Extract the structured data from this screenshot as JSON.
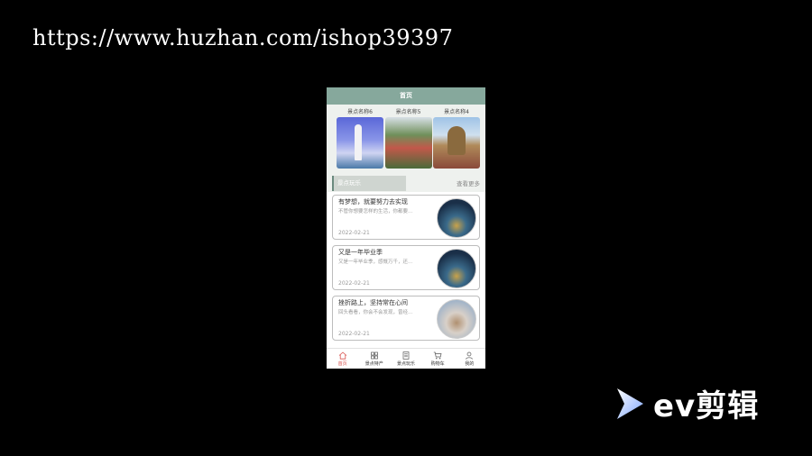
{
  "watermark_url": "https://www.huzhan.com/ishop39397",
  "app": {
    "title": "首页",
    "scenic_spots": [
      {
        "name": "景点名称6",
        "image": "guanyin-statue-photo"
      },
      {
        "name": "景点名称5",
        "image": "mountain-cliff-photo"
      },
      {
        "name": "景点名称4",
        "image": "giant-buddha-photo"
      }
    ],
    "section": {
      "tab_label": "景点玩乐",
      "more_label": "查看更多"
    },
    "articles": [
      {
        "title": "有梦想，就要努力去实现",
        "desc": "不管你想要怎样的生活，你都要...",
        "date": "2022-02-21"
      },
      {
        "title": "又是一年毕业季",
        "desc": "又是一年毕业季，感慨万千，还...",
        "date": "2022-02-21"
      },
      {
        "title": "挫折路上，坚持常在心间",
        "desc": "回头看看，你会不会发现，曾经...",
        "date": "2022-02-21"
      }
    ],
    "tabbar": [
      {
        "label": "首页",
        "icon": "home-icon",
        "active": true
      },
      {
        "label": "景点特产",
        "icon": "grid-icon",
        "active": false
      },
      {
        "label": "景点玩乐",
        "icon": "document-icon",
        "active": false
      },
      {
        "label": "购物车",
        "icon": "cart-icon",
        "active": false
      },
      {
        "label": "我的",
        "icon": "user-icon",
        "active": false
      }
    ]
  },
  "logo": {
    "text": "ev剪辑"
  },
  "colors": {
    "titlebar": "#86a89c",
    "active_tab": "#d9534f"
  }
}
